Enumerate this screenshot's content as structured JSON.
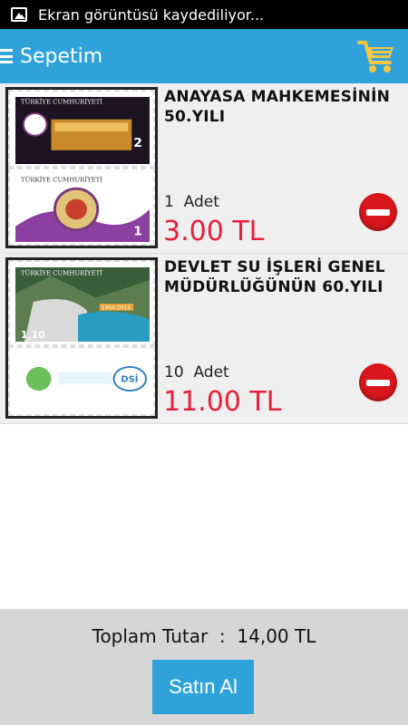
{
  "status_bar": {
    "notification_text": "Ekran görüntüsü kaydediliyor...",
    "icon": "image-icon"
  },
  "app_bar": {
    "title": "Sepetim",
    "menu_icon": "menu-icon",
    "cart_icon": "cart-icon"
  },
  "items": [
    {
      "name": "ANAYASA MAHKEMESİNİN 50.YILI",
      "quantity": "1",
      "quantity_unit": "Adet",
      "price": "3.00 TL",
      "stamp_texts": [
        "TÜRKİYE CUMHURİYETİ",
        "2",
        "TÜRKİYE CUMHURİYETİ",
        "1"
      ]
    },
    {
      "name": "DEVLET SU İŞLERİ GENEL MÜDÜRLÜĞÜNÜN 60.YILI",
      "quantity": "10",
      "quantity_unit": "Adet",
      "price": "11.00 TL",
      "stamp_texts": [
        "TÜRKİYE CUMHURİYETİ",
        "1,10",
        "1954-2014",
        "DSİ"
      ]
    }
  ],
  "footer": {
    "total_label": "Toplam Tutar",
    "total_separator": ":",
    "total_value": "14,00 TL",
    "buy_label": "Satın Al"
  },
  "colors": {
    "accent": "#2fa3d9",
    "price": "#e8203a",
    "remove": "#d8161c",
    "cart": "#f6c542"
  }
}
